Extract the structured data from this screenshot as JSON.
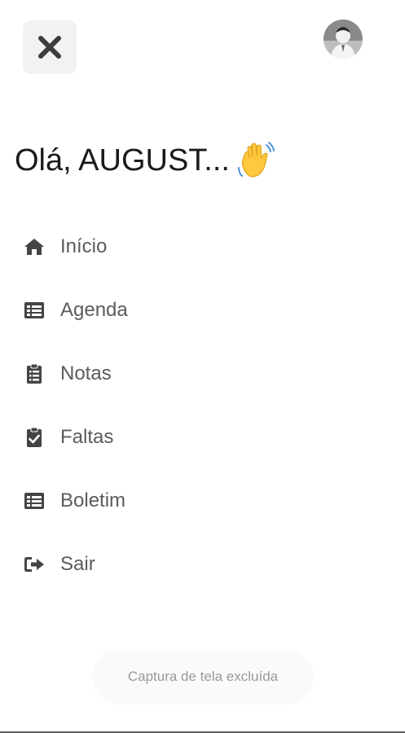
{
  "header": {
    "close_icon": "close-icon",
    "avatar_icon": "user-avatar"
  },
  "greeting": {
    "text": "Olá, AUGUST...",
    "emoji_icon": "waving-hand-icon"
  },
  "menu": {
    "items": [
      {
        "label": "Início",
        "icon": "home-icon"
      },
      {
        "label": "Agenda",
        "icon": "list-icon"
      },
      {
        "label": "Notas",
        "icon": "clipboard-list-icon"
      },
      {
        "label": "Faltas",
        "icon": "clipboard-check-icon"
      },
      {
        "label": "Boletim",
        "icon": "list-icon"
      },
      {
        "label": "Sair",
        "icon": "sign-out-icon"
      }
    ]
  },
  "toast": {
    "text": "Captura de tela excluída"
  },
  "colors": {
    "icon": "#444444",
    "label": "#5b5b5b",
    "close_bg": "#f2f2f2"
  }
}
